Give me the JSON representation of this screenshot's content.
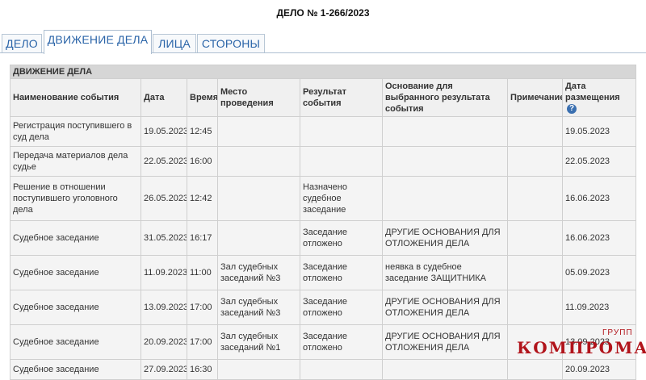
{
  "case": {
    "title": "ДЕЛО № 1-266/2023"
  },
  "tabs": [
    {
      "label": "ДЕЛО"
    },
    {
      "label": "ДВИЖЕНИЕ ДЕЛА"
    },
    {
      "label": "ЛИЦА"
    },
    {
      "label": "СТОРОНЫ"
    }
  ],
  "colors": {
    "tab_text": "#2a64a8",
    "watermark": "#b1141b",
    "section_bg": "#d6d6d6"
  },
  "table": {
    "section_title": "ДВИЖЕНИЕ ДЕЛА",
    "help_icon": "?",
    "columns": [
      "Наименование события",
      "Дата",
      "Время",
      "Место проведения",
      "Результат события",
      "Основание для выбранного результата события",
      "Примечание",
      "Дата размещения"
    ],
    "rows": [
      [
        "Регистрация поступившего в суд дела",
        "19.05.2023",
        "12:45",
        "",
        "",
        "",
        "",
        "19.05.2023"
      ],
      [
        "Передача материалов дела судье",
        "22.05.2023",
        "16:00",
        "",
        "",
        "",
        "",
        "22.05.2023"
      ],
      [
        "Решение в отношении поступившего уголовного дела",
        "26.05.2023",
        "12:42",
        "",
        "Назначено судебное заседание",
        "",
        "",
        "16.06.2023"
      ],
      [
        "Судебное заседание",
        "31.05.2023",
        "16:17",
        "",
        "Заседание отложено",
        "ДРУГИЕ ОСНОВАНИЯ ДЛЯ ОТЛОЖЕНИЯ ДЕЛА",
        "",
        "16.06.2023"
      ],
      [
        "Судебное заседание",
        "11.09.2023",
        "11:00",
        "Зал судебных заседаний №3",
        "Заседание отложено",
        "неявка в судебное заседание ЗАЩИТНИКА",
        "",
        "05.09.2023"
      ],
      [
        "Судебное заседание",
        "13.09.2023",
        "17:00",
        "Зал судебных заседаний №3",
        "Заседание отложено",
        "ДРУГИЕ ОСНОВАНИЯ ДЛЯ ОТЛОЖЕНИЯ ДЕЛА",
        "",
        "11.09.2023"
      ],
      [
        "Судебное заседание",
        "20.09.2023",
        "17:00",
        "Зал судебных заседаний №1",
        "Заседание отложено",
        "ДРУГИЕ ОСНОВАНИЯ ДЛЯ ОТЛОЖЕНИЯ ДЕЛА",
        "",
        "13.09.2023"
      ],
      [
        "Судебное заседание",
        "27.09.2023",
        "16:30",
        "",
        "",
        "",
        "",
        "20.09.2023"
      ]
    ]
  },
  "watermark": {
    "text": "КОМПРОМАТ",
    "sub": "ГРУПП"
  }
}
